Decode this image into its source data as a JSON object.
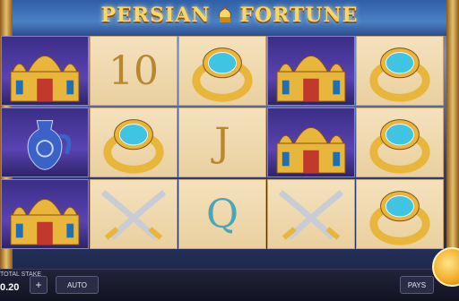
{
  "game": {
    "title_left": "PERSIAN",
    "title_right": "FORTUNE"
  },
  "reels": [
    [
      "palace",
      "ten",
      "ring",
      "palace",
      "ring"
    ],
    [
      "vase",
      "ring",
      "jack",
      "palace",
      "ring"
    ],
    [
      "palace",
      "swords",
      "queen",
      "swords",
      "ring"
    ]
  ],
  "symbols": {
    "ten": "10",
    "jack": "J",
    "queen": "Q"
  },
  "controls": {
    "stake_label": "TOTAL STAKE",
    "stake_value": "0.20",
    "plus_label": "+",
    "auto_label": "AUTO",
    "pays_label": "PAYS"
  },
  "colors": {
    "gold": "#e7b63a",
    "gem": "#3fc4e4",
    "letter_gold": "#b9882d",
    "letter_teal": "#4aa6b6"
  }
}
